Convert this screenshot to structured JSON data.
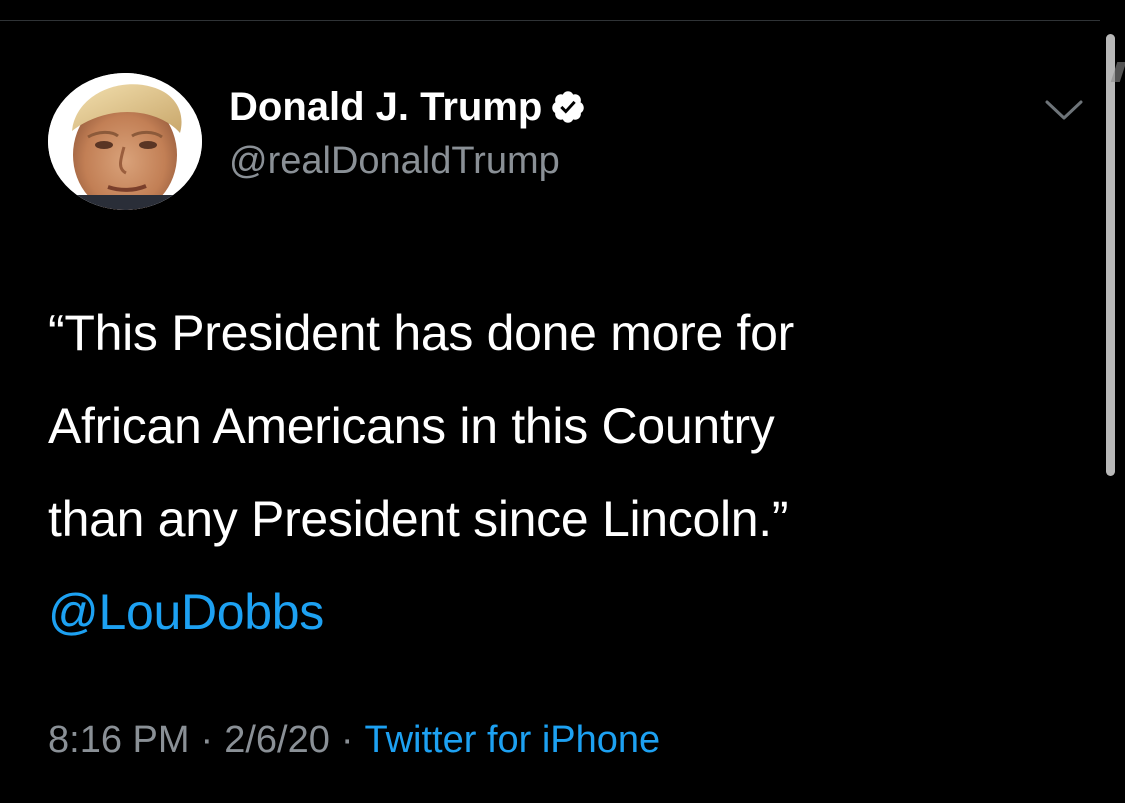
{
  "tweet": {
    "author": {
      "display_name": "Donald J. Trump",
      "handle": "@realDonaldTrump",
      "verified_icon": "verified-badge-icon",
      "avatar_icon": "profile-photo"
    },
    "menu_icon": "chevron-down-icon",
    "text_lines": [
      "“This President has done more for",
      "African Americans in this Country",
      "than any President since Lincoln.”"
    ],
    "mention": "@LouDobbs",
    "time": "8:16 PM",
    "separator": "·",
    "date": "2/6/20",
    "source": "Twitter for iPhone"
  },
  "colors": {
    "background": "#000000",
    "primary_text": "#ffffff",
    "secondary_text": "#8a9096",
    "link": "#1da1f2",
    "divider": "#2f3336"
  }
}
